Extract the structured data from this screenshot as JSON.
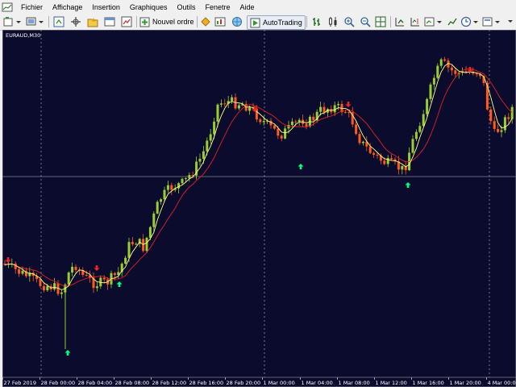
{
  "menu": [
    "Fichier",
    "Affichage",
    "Insertion",
    "Graphiques",
    "Outils",
    "Fenetre",
    "Aide"
  ],
  "toolbar": {
    "new_order_label": "Nouvel ordre",
    "autotrading_label": "AutoTrading"
  },
  "chart": {
    "symbol_label": "EURAUD,M30",
    "time_labels": [
      "27 Feb 2019",
      "28 Feb 00:00",
      "28 Feb 04:00",
      "28 Feb 08:00",
      "28 Feb 12:00",
      "28 Feb 16:00",
      "28 Feb 20:00",
      "1 Mar 00:00",
      "1 Mar 04:00",
      "1 Mar 08:00",
      "1 Mar 12:00",
      "1 Mar 16:00",
      "1 Mar 20:00",
      "4 Mar 00:00"
    ],
    "colors": {
      "background": "#0b0b2e",
      "bull": "#9acd32",
      "bear": "#ff5a1f",
      "fast_ma": "#ffff80",
      "slow_ma": "#e02020",
      "arrow_up": "#00ff7f",
      "arrow_down": "#ff2020",
      "grid": "#c0c0c0"
    }
  }
}
